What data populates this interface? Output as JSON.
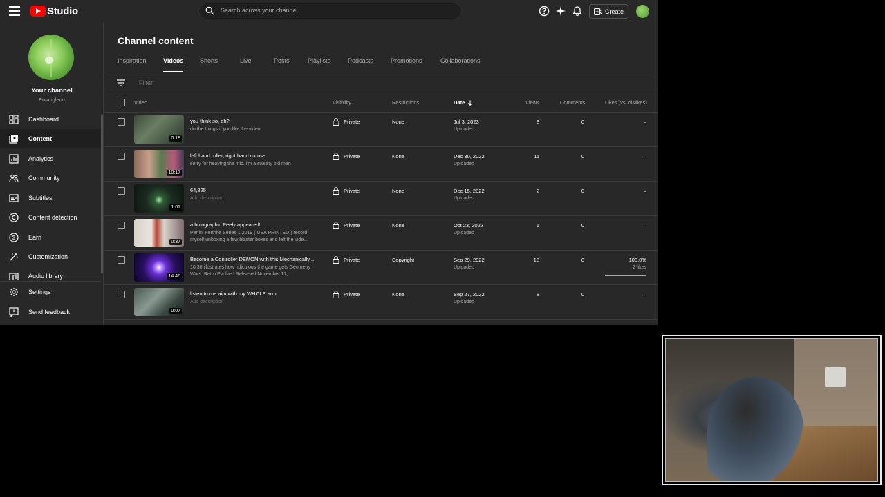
{
  "header": {
    "logo_text": "Studio",
    "search_placeholder": "Search across your channel",
    "create_label": "Create"
  },
  "sidebar": {
    "channel_name": "Your channel",
    "channel_handle": "Entangleon",
    "items": [
      {
        "label": "Dashboard",
        "icon": "dashboard-icon"
      },
      {
        "label": "Content",
        "icon": "content-icon",
        "active": true
      },
      {
        "label": "Analytics",
        "icon": "analytics-icon"
      },
      {
        "label": "Community",
        "icon": "community-icon"
      },
      {
        "label": "Subtitles",
        "icon": "subtitles-icon"
      },
      {
        "label": "Content detection",
        "icon": "copyright-icon"
      },
      {
        "label": "Earn",
        "icon": "earn-icon"
      },
      {
        "label": "Customization",
        "icon": "customization-icon"
      },
      {
        "label": "Audio library",
        "icon": "audio-library-icon"
      }
    ],
    "bottom_items": [
      {
        "label": "Settings",
        "icon": "gear-icon"
      },
      {
        "label": "Send feedback",
        "icon": "feedback-icon"
      }
    ]
  },
  "main": {
    "title": "Channel content",
    "tabs": [
      "Inspiration",
      "Videos",
      "Shorts",
      "Live",
      "Posts",
      "Playlists",
      "Podcasts",
      "Promotions",
      "Collaborations"
    ],
    "active_tab": "Videos",
    "filter_placeholder": "Filter",
    "columns": {
      "video": "Video",
      "visibility": "Visibility",
      "restrictions": "Restrictions",
      "date": "Date",
      "views": "Views",
      "comments": "Comments",
      "likes": "Likes (vs. dislikes)"
    },
    "rows": [
      {
        "title": "you think so, eh?",
        "description": "do the things if you like the video",
        "duration": "0:18",
        "visibility": "Private",
        "restrictions": "None",
        "date": "Jul 3, 2023",
        "date_status": "Uploaded",
        "views": "8",
        "comments": "0",
        "likes": "–",
        "likes_sub": ""
      },
      {
        "title": "left hand roller, right hand mouse",
        "description": "sorry for heaving the mic. i'm a sweaty old man",
        "duration": "10:17",
        "visibility": "Private",
        "restrictions": "None",
        "date": "Dec 30, 2022",
        "date_status": "Uploaded",
        "views": "11",
        "comments": "0",
        "likes": "–",
        "likes_sub": ""
      },
      {
        "title": "64,825",
        "description": "Add description",
        "description_placeholder": true,
        "duration": "1:01",
        "visibility": "Private",
        "restrictions": "None",
        "date": "Dec 15, 2022",
        "date_status": "Uploaded",
        "views": "2",
        "comments": "0",
        "likes": "–",
        "likes_sub": ""
      },
      {
        "title": "a holographic Peely appeared!",
        "description": "Panini Fortnite Series 1 2019 ( USA PRINTED ) record myself unboxing a few blaster boxes and felt the vide...",
        "duration": "0:37",
        "visibility": "Private",
        "restrictions": "None",
        "date": "Oct 23, 2022",
        "date_status": "Uploaded",
        "views": "6",
        "comments": "0",
        "likes": "–",
        "likes_sub": ""
      },
      {
        "title": "Become a Controller DEMON with this Mechanically ...",
        "description": "10:30 illustrates how ridiculous the game gets Geometry Wars: Retro Evolved Released November 17,...",
        "duration": "14:46",
        "visibility": "Private",
        "restrictions": "Copyright",
        "date": "Sep 29, 2022",
        "date_status": "Uploaded",
        "views": "18",
        "comments": "0",
        "likes": "100.0%",
        "likes_sub": "2 likes",
        "likes_ratio": 1.0
      },
      {
        "title": "listen to me aim with my WHOLE arm",
        "description": "Add description",
        "description_placeholder": true,
        "duration": "0:07",
        "visibility": "Private",
        "restrictions": "None",
        "date": "Sep 27, 2022",
        "date_status": "Uploaded",
        "views": "8",
        "comments": "0",
        "likes": "–",
        "likes_sub": ""
      }
    ]
  },
  "colors": {
    "background": "#282828",
    "logo_red": "#ff0000",
    "text_secondary": "#aaaaaa"
  }
}
